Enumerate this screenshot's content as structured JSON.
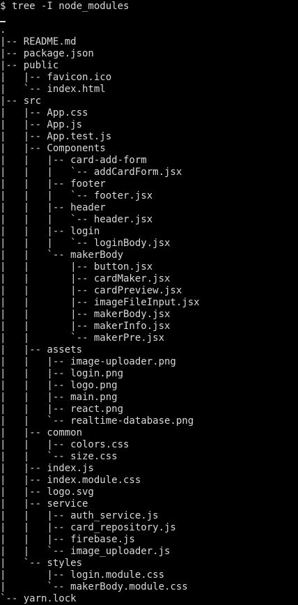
{
  "terminal": {
    "prompt": "$ tree -I node_modules",
    "lines": [
      ".",
      "|-- README.md",
      "|-- package.json",
      "|-- public",
      "|   |-- favicon.ico",
      "|   `-- index.html",
      "|-- src",
      "|   |-- App.css",
      "|   |-- App.js",
      "|   |-- App.test.js",
      "|   |-- Components",
      "|   |   |-- card-add-form",
      "|   |   |   `-- addCardForm.jsx",
      "|   |   |-- footer",
      "|   |   |   `-- footer.jsx",
      "|   |   |-- header",
      "|   |   |   `-- header.jsx",
      "|   |   |-- login",
      "|   |   |   `-- loginBody.jsx",
      "|   |   `-- makerBody",
      "|   |       |-- button.jsx",
      "|   |       |-- cardMaker.jsx",
      "|   |       |-- cardPreview.jsx",
      "|   |       |-- imageFileInput.jsx",
      "|   |       |-- makerBody.jsx",
      "|   |       |-- makerInfo.jsx",
      "|   |       `-- makerPre.jsx",
      "|   |-- assets",
      "|   |   |-- image-uploader.png",
      "|   |   |-- login.png",
      "|   |   |-- logo.png",
      "|   |   |-- main.png",
      "|   |   |-- react.png",
      "|   |   `-- realtime-database.png",
      "|   |-- common",
      "|   |   |-- colors.css",
      "|   |   `-- size.css",
      "|   |-- index.js",
      "|   |-- index.module.css",
      "|   |-- logo.svg",
      "|   |-- service",
      "|   |   |-- auth_service.js",
      "|   |   |-- card_repository.js",
      "|   |   |-- firebase.js",
      "|   |   `-- image_uploader.js",
      "|   `-- styles",
      "|       |-- login.module.css",
      "|       `-- makerBody.module.css",
      "`-- yarn.lock"
    ]
  },
  "colors": {
    "background": "#000000",
    "foreground": "#d9d9d9"
  }
}
